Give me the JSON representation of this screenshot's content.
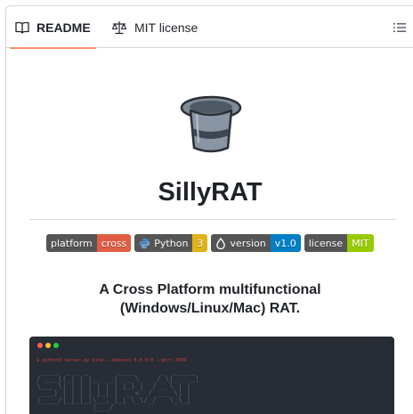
{
  "tabs": [
    {
      "label": "README",
      "icon": "book-icon",
      "active": true
    },
    {
      "label": "MIT license",
      "icon": "scale-icon",
      "active": false
    }
  ],
  "outline_icon": "list-outline-icon",
  "readme": {
    "logo_icon": "top-hat-icon",
    "title": "SillyRAT",
    "badges": [
      {
        "left": "platform",
        "right": "cross",
        "color": "#e05d44",
        "icon": null
      },
      {
        "left": "Python",
        "right": "3",
        "color": "#dfb317",
        "icon": "python-icon"
      },
      {
        "left": "version",
        "right": "v1.0",
        "color": "#007ec6",
        "icon": "drop-icon"
      },
      {
        "left": "license",
        "right": "MIT",
        "color": "#97ca00",
        "icon": null
      }
    ],
    "description_line1": "A Cross Platform multifunctional",
    "description_line2": "(Windows/Linux/Mac) RAT.",
    "terminal": {
      "dot_colors": [
        "#ff5f56",
        "#ffbd2e",
        "#27c93f"
      ],
      "command": "$ python3 server.py bind --address 0.0.0.0 --port 3999"
    }
  }
}
